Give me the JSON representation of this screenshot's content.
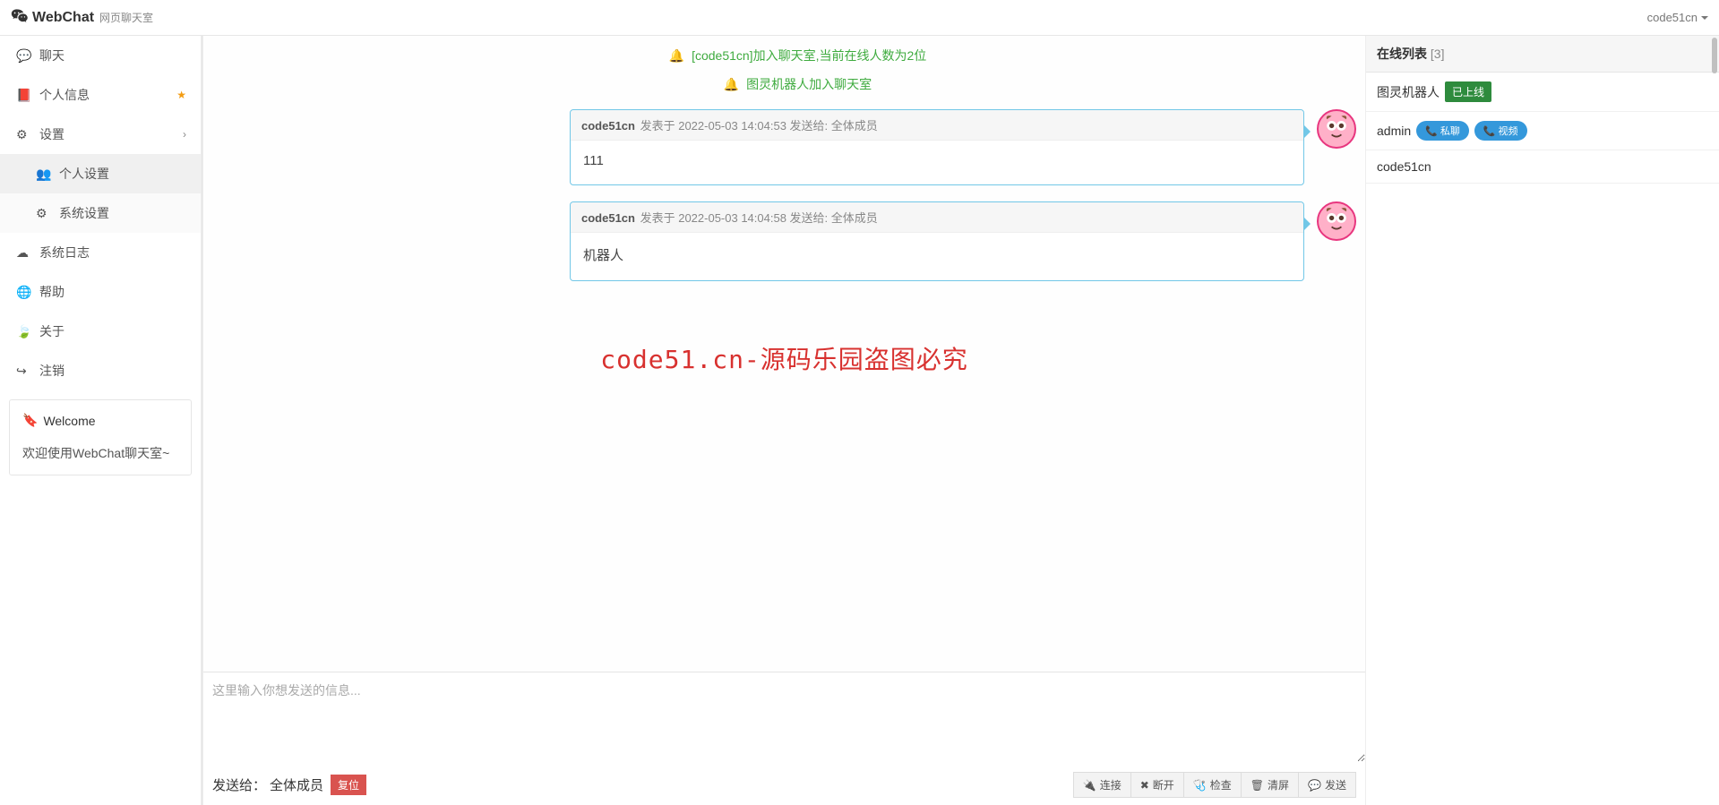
{
  "header": {
    "brand": "WebChat",
    "subtitle": "网页聊天室",
    "username": "code51cn"
  },
  "sidebar": {
    "items": {
      "chat": "聊天",
      "profile": "个人信息",
      "settings": "设置",
      "personal_settings": "个人设置",
      "system_settings": "系统设置",
      "syslog": "系统日志",
      "help": "帮助",
      "about": "关于",
      "logout": "注销"
    },
    "welcome": {
      "title": "Welcome",
      "text": "欢迎使用WebChat聊天室~"
    }
  },
  "chat": {
    "system": {
      "join1": "[code51cn]加入聊天室,当前在线人数为2位",
      "join2": "图灵机器人加入聊天室"
    },
    "messages": [
      {
        "user": "code51cn",
        "meta": "发表于 2022-05-03 14:04:53 发送给: 全体成员",
        "body": "111"
      },
      {
        "user": "code51cn",
        "meta": "发表于 2022-05-03 14:04:58 发送给: 全体成员",
        "body": "机器人"
      }
    ],
    "watermark": "code51.cn-源码乐园盗图必究",
    "input_placeholder": "这里输入你想发送的信息...",
    "send_to_label": "发送给：",
    "send_to_target": "全体成员",
    "reset": "复位",
    "buttons": {
      "connect": "连接",
      "disconnect": "断开",
      "inspect": "检查",
      "clear": "清屏",
      "send": "发送"
    }
  },
  "online": {
    "title": "在线列表",
    "count": "[3]",
    "bot_name": "图灵机器人",
    "bot_status": "已上线",
    "admin_name": "admin",
    "btn_private": "私聊",
    "btn_video": "视频",
    "self_name": "code51cn"
  }
}
